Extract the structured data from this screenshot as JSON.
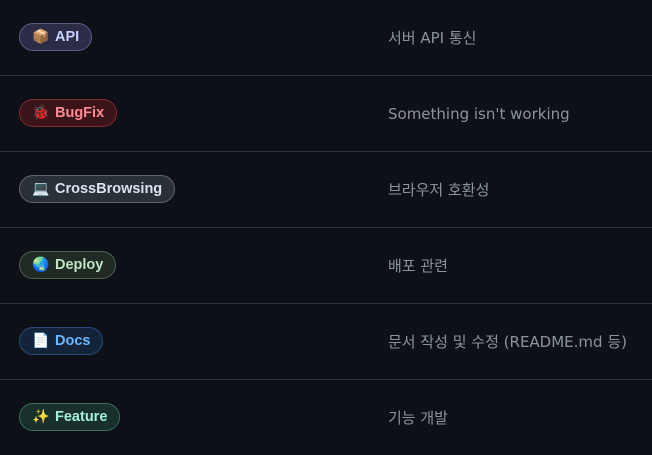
{
  "labels": [
    {
      "name": "API",
      "icon": "package-icon",
      "glyph": "📦",
      "description": "서버 API 통신",
      "bg": "#2b2d47",
      "border": "#595d85",
      "text": "#c9d1ff",
      "icon_color": "#7aa8ff"
    },
    {
      "name": "BugFix",
      "icon": "bug-icon",
      "glyph": "🐞",
      "description": "Something isn't working",
      "bg": "#3a1418",
      "border": "#7d2a33",
      "text": "#ff8a96",
      "icon_color": "#e5364a"
    },
    {
      "name": "CrossBrowsing",
      "icon": "laptop-icon",
      "glyph": "💻",
      "description": "브라우저 호환성",
      "bg": "#2a3038",
      "border": "#5b6470",
      "text": "#dbe3ee",
      "icon_color": "#6cb6ff"
    },
    {
      "name": "Deploy",
      "icon": "globe-icon",
      "glyph": "🌏",
      "description": "배포 관련",
      "bg": "#1f2a23",
      "border": "#4c5f52",
      "text": "#bfe3c7",
      "icon_color": "#3fb950"
    },
    {
      "name": "Docs",
      "icon": "page-icon",
      "glyph": "📄",
      "description": "문서 작성 및 수정 (README.md 등)",
      "bg": "#132339",
      "border": "#274b7a",
      "text": "#6cb6ff",
      "icon_color": "#e6edf3"
    },
    {
      "name": "Feature",
      "icon": "sparkles-icon",
      "glyph": "✨",
      "description": "기능 개발",
      "bg": "#17302c",
      "border": "#3b6a60",
      "text": "#a5f0dd",
      "icon_color": "#f2cc60"
    }
  ]
}
